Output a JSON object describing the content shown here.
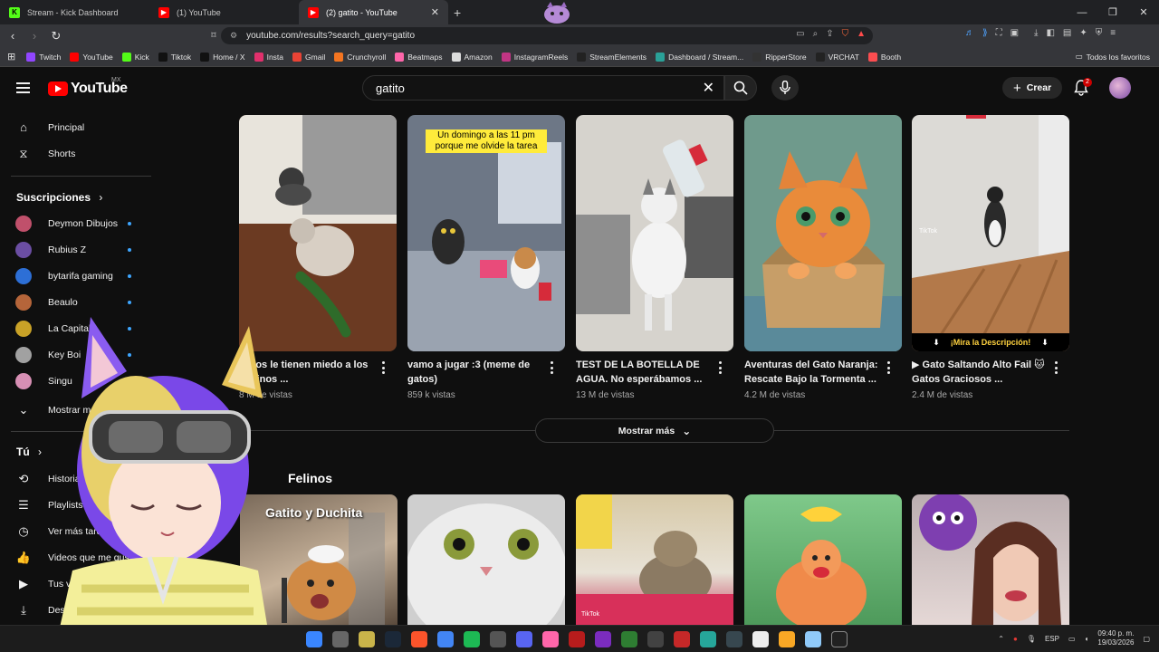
{
  "browser": {
    "tabs": [
      {
        "label": "Stream - Kick Dashboard",
        "favicon_color": "#53fc18",
        "favicon_glyph": "K",
        "active": false
      },
      {
        "label": "(1) YouTube",
        "favicon_color": "#ff0000",
        "favicon_glyph": "▶",
        "active": false
      },
      {
        "label": "(2) gatito - YouTube",
        "favicon_color": "#ff0000",
        "favicon_glyph": "▶",
        "active": true
      }
    ],
    "url": "youtube.com/results?search_query=gatito",
    "bookmarks": [
      {
        "label": "Twitch",
        "color": "#9146ff"
      },
      {
        "label": "YouTube",
        "color": "#ff0000"
      },
      {
        "label": "Kick",
        "color": "#53fc18"
      },
      {
        "label": "Tiktok",
        "color": "#111111"
      },
      {
        "label": "Home / X",
        "color": "#111111"
      },
      {
        "label": "Insta",
        "color": "#e1306c"
      },
      {
        "label": "Gmail",
        "color": "#ea4335"
      },
      {
        "label": "Crunchyroll",
        "color": "#f47521"
      },
      {
        "label": "Beatmaps",
        "color": "#ff66aa"
      },
      {
        "label": "Amazon",
        "color": "#dddddd"
      },
      {
        "label": "InstagramReels",
        "color": "#c13584"
      },
      {
        "label": "StreamElements",
        "color": "#222222"
      },
      {
        "label": "Dashboard / Stream...",
        "color": "#2aa198"
      },
      {
        "label": "RipperStore",
        "color": "#333333"
      },
      {
        "label": "VRCHAT",
        "color": "#222222"
      },
      {
        "label": "Booth",
        "color": "#fc4d50"
      }
    ],
    "bookmarks_right": "Todos los favoritos"
  },
  "youtube": {
    "logo_text": "YouTube",
    "country": "MX",
    "search_value": "gatito",
    "create_label": "Crear",
    "notifications_count": "2",
    "sidebar": {
      "main_items": [
        {
          "label": "Principal",
          "icon": "home-icon"
        },
        {
          "label": "Shorts",
          "icon": "shorts-icon"
        }
      ],
      "subs_title": "Suscripciones",
      "subscriptions": [
        {
          "label": "Deymon Dibujos",
          "color": "#c0506b"
        },
        {
          "label": "Rubius Z",
          "color": "#6b4ea3"
        },
        {
          "label": "bytarifa gaming",
          "color": "#2d6fd6"
        },
        {
          "label": "Beaulo",
          "color": "#b5653a"
        },
        {
          "label": "La Capital",
          "color": "#c9a227"
        },
        {
          "label": "Key Boi",
          "color": "#a1a1a1"
        },
        {
          "label": "Singu",
          "color": "#d78fb4"
        }
      ],
      "show_more": "Mostrar más",
      "you_title": "Tú",
      "you_items": [
        {
          "label": "Historial",
          "icon": "history-icon"
        },
        {
          "label": "Playlists",
          "icon": "playlist-icon"
        },
        {
          "label": "Ver más tarde",
          "icon": "clock-icon"
        },
        {
          "label": "Videos que me gustan",
          "icon": "like-icon"
        },
        {
          "label": "Tus videos",
          "icon": "video-icon"
        },
        {
          "label": "Descargas",
          "icon": "download-icon"
        }
      ]
    },
    "videos": [
      {
        "title": "Gatos le tienen miedo a los pepinos ...",
        "views": "8 M de vistas",
        "thumb": "cucumber"
      },
      {
        "title": "vamo a jugar :3 (meme de gatos)",
        "views": "859 k vistas",
        "thumb": "meme",
        "caption": "Un domingo a las 11 pm porque me olvide la tarea"
      },
      {
        "title": "TEST DE LA BOTELLA DE AGUA. No esperábamos ...",
        "views": "13 M de vistas",
        "thumb": "bottle"
      },
      {
        "title": "Aventuras del Gato Naranja: Rescate Bajo la Tormenta ...",
        "views": "4.2 M de vistas",
        "thumb": "orange"
      },
      {
        "title": "▶ Gato Saltando Alto Fail 🐱 Gatos Graciosos ...",
        "views": "2.4 M de vistas",
        "thumb": "jump",
        "bar": "¡Mira la Descripción!"
      }
    ],
    "more_button": "Mostrar más",
    "shelf_title": "Felinos",
    "shelf_overlay": "Gatito y Duchita"
  },
  "taskbar": {
    "language": "ESP",
    "time": "09:40 p. m.",
    "date": "19/03/2026"
  }
}
